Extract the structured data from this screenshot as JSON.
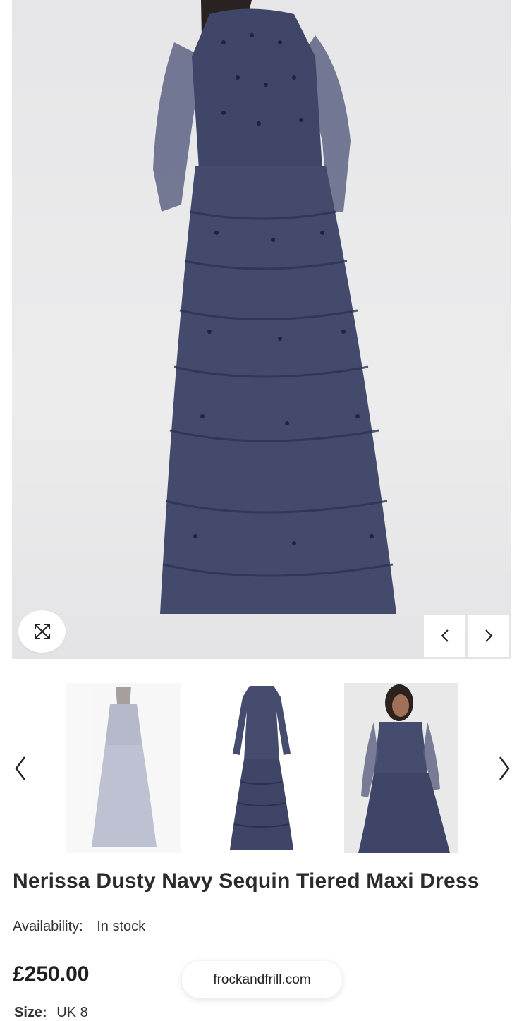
{
  "gallery": {
    "main_image_alt": "Nerissa Dusty Navy Sequin Tiered Maxi Dress back view",
    "zoom_icon": "expand-icon",
    "prev_icon": "chevron-left-icon",
    "next_icon": "chevron-right-icon",
    "thumbnails": [
      {
        "alt": "Dress back view on model"
      },
      {
        "alt": "Dress front flat view"
      },
      {
        "alt": "Dress front view on model"
      }
    ]
  },
  "product": {
    "title": "Nerissa Dusty Navy Sequin Tiered Maxi Dress",
    "availability_label": "Availability:",
    "availability_value": "In stock",
    "price": "£250.00",
    "size_label": "Size:",
    "size_value": "UK 8"
  },
  "browser": {
    "url": "frockandfrill.com"
  },
  "colors": {
    "dress_navy": "#3d4566",
    "background": "#ffffff"
  }
}
